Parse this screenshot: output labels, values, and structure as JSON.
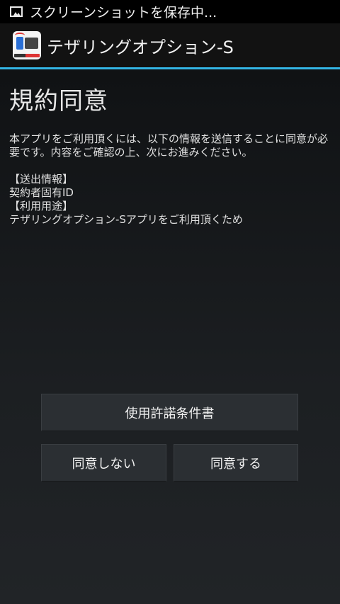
{
  "status_bar": {
    "icon": "image-icon",
    "notification_text": "スクリーンショットを保存中..."
  },
  "action_bar": {
    "app_icon": "tethering-app-icon",
    "title": "テザリングオプション-S"
  },
  "colors": {
    "accent_line": "#33b5e5",
    "button_bg": "#2b2f33"
  },
  "page": {
    "title": "規約同意",
    "intro": "本アプリをご利用頂くには、以下の情報を送信することに同意が必要です。内容をご確認の上、次にお進みください。",
    "send_info_header": "【送出情報】",
    "send_info_value": "契約者固有ID",
    "usage_header": "【利用用途】",
    "usage_value": "テザリングオプション-Sアプリをご利用頂くため"
  },
  "buttons": {
    "license_label": "使用許諾条件書",
    "disagree_label": "同意しない",
    "agree_label": "同意する"
  }
}
